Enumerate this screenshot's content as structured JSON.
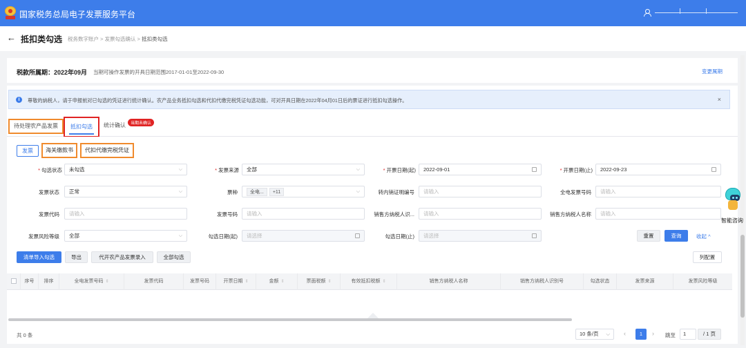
{
  "app": {
    "title": "国家税务总局电子发票服务平台"
  },
  "header": {
    "back_icon": "left-arrow-icon",
    "title": "抵扣类勾选",
    "breadcrumbs": [
      "税务数字账户",
      "发票勾选确认",
      "抵扣类勾选"
    ]
  },
  "period": {
    "label": "税款所属期：2022年09月",
    "note": "当期可操作发票的开具日期范围2017-01-01至2022-09-30",
    "change_link": "变更属期"
  },
  "notice": {
    "text": "尊敬的纳税人，请于申报前对已勾选的凭证进行统计确认。农产品业务抵扣勾选和代扣代缴完税凭证勾选功能，可对开具日期在2022年04月01日后的票证进行抵扣勾选操作。",
    "close": "×"
  },
  "tabs": [
    {
      "label": "待处理农产品发票"
    },
    {
      "label": "抵扣勾选"
    },
    {
      "label": "统计确认",
      "badge": "当期未确认"
    }
  ],
  "subtabs": [
    "发票",
    "海关缴款书",
    "代扣代缴完税凭证"
  ],
  "filters": {
    "gxzt": {
      "label": "勾选状态",
      "value": "未勾选"
    },
    "fply": {
      "label": "发票来源",
      "value": "全部"
    },
    "kprq_start": {
      "label": "开票日期(起)",
      "value": "2022-09-01"
    },
    "kprq_end": {
      "label": "开票日期(止)",
      "value": "2022-09-23"
    },
    "fpzt": {
      "label": "发票状态",
      "value": "正常"
    },
    "pz": {
      "label": "票种",
      "chip1": "全电...",
      "chip2": "+11"
    },
    "znzm": {
      "label": "转内销证明编号",
      "placeholder": "请输入"
    },
    "qdfphm": {
      "label": "全电发票号码",
      "placeholder": "请输入"
    },
    "fpdm": {
      "label": "发票代码",
      "placeholder": "请输入"
    },
    "fphm": {
      "label": "发票号码",
      "placeholder": "请输入"
    },
    "xfsbh": {
      "label": "销售方纳税人识...",
      "placeholder": "请输入"
    },
    "xfmc": {
      "label": "销售方纳税人名称",
      "placeholder": "请输入"
    },
    "fxdj": {
      "label": "发票风险等级",
      "value": "全部"
    },
    "gxrq_start": {
      "label": "勾选日期(起)",
      "placeholder": "请选择"
    },
    "gxrq_end": {
      "label": "勾选日期(止)",
      "placeholder": "请选择"
    }
  },
  "actions": {
    "reset": "重置",
    "search": "查询",
    "collapse": "收起 ^"
  },
  "toolbar": {
    "import": "清单导入勾选",
    "export": "导出",
    "agri_entry": "代开农产品发票录入",
    "select_all": "全部勾选",
    "columns": "列配置"
  },
  "table": {
    "columns": [
      "序号",
      "排序",
      "全电发票号码",
      "发票代码",
      "发票号码",
      "开票日期",
      "金额",
      "票面税额",
      "有效抵扣税额",
      "销售方纳税人名称",
      "销售方纳税人识别号",
      "勾选状态",
      "发票来源",
      "发票风险等级"
    ]
  },
  "pagination": {
    "total": "共 0 条",
    "page_size": "10 条/页",
    "current": "1",
    "goto_label": "跳至",
    "goto_value": "1",
    "pages": "/ 1 页"
  },
  "assistant": {
    "label": "智能咨询"
  }
}
